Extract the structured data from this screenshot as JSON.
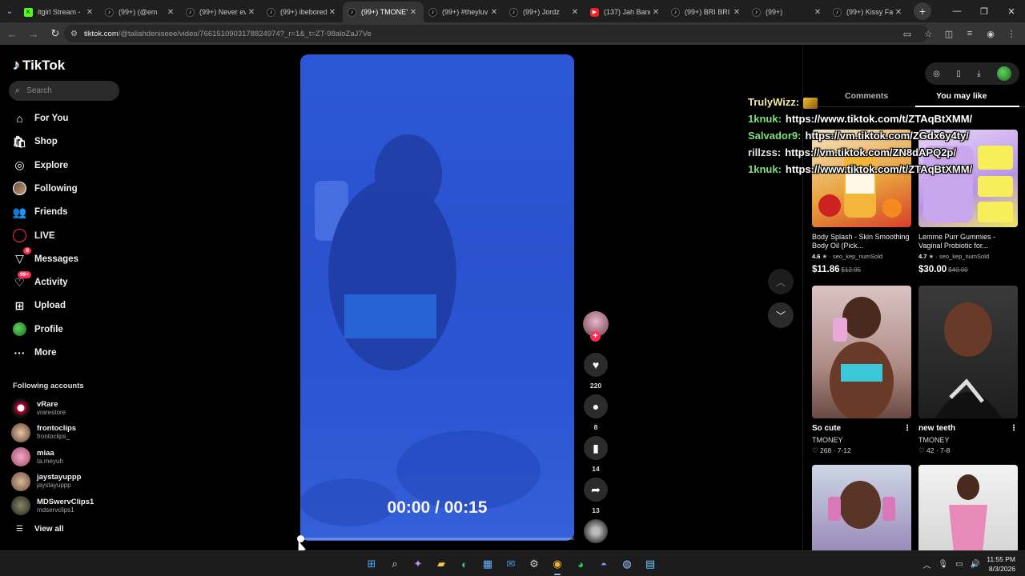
{
  "browser": {
    "tabs": [
      {
        "title": "itgirl Stream - ",
        "favicon": "kick-icon"
      },
      {
        "title": "(99+) (@em",
        "favicon": "tiktok-icon"
      },
      {
        "title": "(99+) Never ev",
        "favicon": "tiktok-icon"
      },
      {
        "title": "(99+) ibebored",
        "favicon": "tiktok-icon"
      },
      {
        "title": "(99+) TMONEY",
        "favicon": "tiktok-icon",
        "active": true
      },
      {
        "title": "(99+) #theyluv",
        "favicon": "tiktok-icon"
      },
      {
        "title": "(99+) Jordz",
        "favicon": "tiktok-icon"
      },
      {
        "title": "(137) Jah Band",
        "favicon": "youtube-icon"
      },
      {
        "title": "(99+) BRI BRI",
        "favicon": "tiktok-icon"
      },
      {
        "title": "(99+)",
        "favicon": "tiktok-icon"
      },
      {
        "title": "(99+) Kissy Fac",
        "favicon": "tiktok-icon"
      }
    ],
    "url_domain": "tiktok.com",
    "url_path": "/@taliahdeniseee/video/7661510903178824974?_r=1&_t=ZT-98aloZaJ7Ve"
  },
  "sidebar": {
    "logo": "TikTok",
    "search_placeholder": "Search",
    "nav": [
      {
        "label": "For You",
        "icon": "home-icon"
      },
      {
        "label": "Shop",
        "icon": "shop-icon"
      },
      {
        "label": "Explore",
        "icon": "compass-icon"
      },
      {
        "label": "Following",
        "icon": "following-avatar-icon"
      },
      {
        "label": "Friends",
        "icon": "friends-icon"
      },
      {
        "label": "LIVE",
        "icon": "live-icon"
      },
      {
        "label": "Messages",
        "icon": "messages-icon",
        "badge": "8"
      },
      {
        "label": "Activity",
        "icon": "activity-icon",
        "badge": "99+"
      },
      {
        "label": "Upload",
        "icon": "upload-icon"
      },
      {
        "label": "Profile",
        "icon": "profile-avatar-icon"
      },
      {
        "label": "More",
        "icon": "more-icon"
      }
    ],
    "following_title": "Following accounts",
    "accounts": [
      {
        "name": "vRare",
        "handle": "vrarestore"
      },
      {
        "name": "frontoclips",
        "handle": "frontoclips_"
      },
      {
        "name": "miaa",
        "handle": "ta.meyuh"
      },
      {
        "name": "jaystayuppp",
        "handle": "jaystayuppp"
      },
      {
        "name": "MDSwervClips1",
        "handle": "mdservclips1"
      }
    ],
    "view_all": "View all"
  },
  "video": {
    "timecode": "00:00 / 00:15",
    "progress": 0.0
  },
  "actions": {
    "likes": "220",
    "comments": "8",
    "saves": "14",
    "shares": "13"
  },
  "right_panel": {
    "tabs": [
      "Comments",
      "You may like"
    ],
    "active_tab": "You may like",
    "products": [
      {
        "title": "Body Splash - Skin Smoothing Body Oil (Pick...",
        "rating": "4.6",
        "sold": "seo_kep_numSold",
        "price": "$11.86",
        "old_price": "$12.95"
      },
      {
        "title": "Lemme Purr Gummies - Vaginal Probiotic for...",
        "rating": "4.7",
        "sold": "seo_kep_numSold",
        "price": "$30.00",
        "old_price": "$40.00"
      }
    ],
    "videos": [
      {
        "title": "So cute",
        "author": "TMONEY",
        "likes": "268",
        "date": "7-12"
      },
      {
        "title": "new teeth",
        "author": "TMONEY",
        "likes": "42",
        "date": "7-8"
      }
    ]
  },
  "chat": [
    {
      "user": "TrulyWizz:",
      "message": "",
      "color": "#f1e8a0",
      "emote": true
    },
    {
      "user": "1knuk:",
      "message": "https://www.tiktok.com/t/ZTAqBtXMM/",
      "color": "#7de07d"
    },
    {
      "user": "Salvador9:",
      "message": "https://vm.tiktok.com/ZGdx6y4ty/",
      "color": "#7de07d"
    },
    {
      "user": "rillzss:",
      "message": "https://vm.tiktok.com/ZN8dAPQ2p/",
      "color": "#e0e0e0"
    },
    {
      "user": "1knuk:",
      "message": "https://www.tiktok.com/t/ZTAqBtXMM/",
      "color": "#7de07d"
    }
  ],
  "taskbar": {
    "time": "11:55 PM",
    "date": "8/3/2026"
  }
}
